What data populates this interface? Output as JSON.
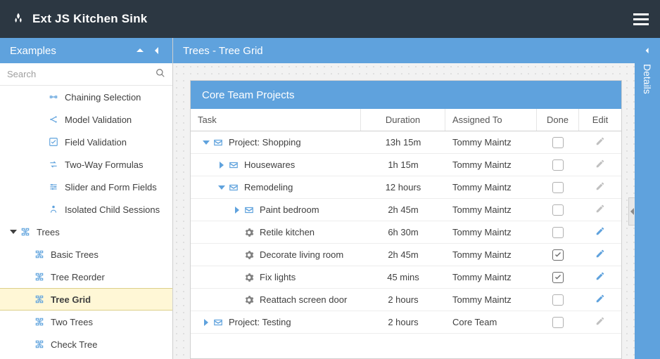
{
  "header": {
    "app_title": "Ext JS Kitchen Sink"
  },
  "sidebar": {
    "title": "Examples",
    "search_placeholder": "Search",
    "items": [
      {
        "label": "Chaining Selection",
        "depth": 2,
        "icon": "link",
        "expanded": null
      },
      {
        "label": "Model Validation",
        "depth": 2,
        "icon": "share",
        "expanded": null
      },
      {
        "label": "Field Validation",
        "depth": 2,
        "icon": "check",
        "expanded": null
      },
      {
        "label": "Two-Way Formulas",
        "depth": 2,
        "icon": "swap",
        "expanded": null
      },
      {
        "label": "Slider and Form Fields",
        "depth": 2,
        "icon": "sliders",
        "expanded": null
      },
      {
        "label": "Isolated Child Sessions",
        "depth": 2,
        "icon": "child",
        "expanded": null
      },
      {
        "label": "Trees",
        "depth": 0,
        "icon": "tree",
        "expanded": true
      },
      {
        "label": "Basic Trees",
        "depth": 1,
        "icon": "tree",
        "expanded": null
      },
      {
        "label": "Tree Reorder",
        "depth": 1,
        "icon": "tree",
        "expanded": null
      },
      {
        "label": "Tree Grid",
        "depth": 1,
        "icon": "tree",
        "expanded": null,
        "selected": true
      },
      {
        "label": "Two Trees",
        "depth": 1,
        "icon": "tree",
        "expanded": null
      },
      {
        "label": "Check Tree",
        "depth": 1,
        "icon": "tree",
        "expanded": null
      }
    ]
  },
  "content": {
    "panel_title": "Trees - Tree Grid",
    "grid_title": "Core Team Projects",
    "columns": {
      "task": "Task",
      "duration": "Duration",
      "assigned": "Assigned To",
      "done": "Done",
      "edit": "Edit"
    },
    "rows": [
      {
        "indent": 0,
        "expand": "down",
        "icon": "folder",
        "task": "Project: Shopping",
        "duration": "13h 15m",
        "assigned": "Tommy Maintz",
        "done": false,
        "edit_active": false
      },
      {
        "indent": 1,
        "expand": "right",
        "icon": "folder",
        "task": "Housewares",
        "duration": "1h 15m",
        "assigned": "Tommy Maintz",
        "done": false,
        "edit_active": false
      },
      {
        "indent": 1,
        "expand": "down",
        "icon": "folder",
        "task": "Remodeling",
        "duration": "12 hours",
        "assigned": "Tommy Maintz",
        "done": false,
        "edit_active": false
      },
      {
        "indent": 2,
        "expand": "right",
        "icon": "folder",
        "task": "Paint bedroom",
        "duration": "2h 45m",
        "assigned": "Tommy Maintz",
        "done": false,
        "edit_active": false
      },
      {
        "indent": 2,
        "expand": null,
        "icon": "leaf",
        "task": "Retile kitchen",
        "duration": "6h 30m",
        "assigned": "Tommy Maintz",
        "done": false,
        "edit_active": true
      },
      {
        "indent": 2,
        "expand": null,
        "icon": "leaf",
        "task": "Decorate living room",
        "duration": "2h 45m",
        "assigned": "Tommy Maintz",
        "done": true,
        "edit_active": true
      },
      {
        "indent": 2,
        "expand": null,
        "icon": "leaf",
        "task": "Fix lights",
        "duration": "45 mins",
        "assigned": "Tommy Maintz",
        "done": true,
        "edit_active": true
      },
      {
        "indent": 2,
        "expand": null,
        "icon": "leaf",
        "task": "Reattach screen door",
        "duration": "2 hours",
        "assigned": "Tommy Maintz",
        "done": false,
        "edit_active": true
      },
      {
        "indent": 0,
        "expand": "right",
        "icon": "folder",
        "task": "Project: Testing",
        "duration": "2 hours",
        "assigned": "Core Team",
        "done": false,
        "edit_active": false
      }
    ]
  },
  "details": {
    "label": "Details"
  }
}
